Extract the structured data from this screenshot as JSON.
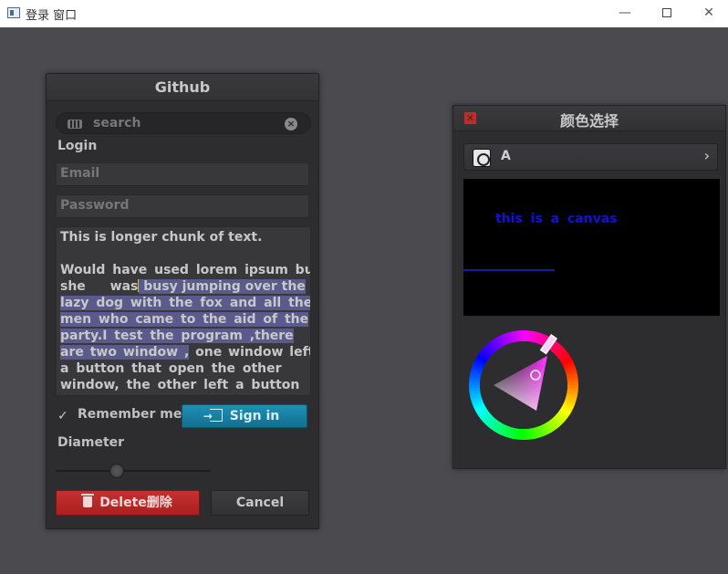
{
  "window": {
    "title": "登录 窗口",
    "minimize": "—",
    "close": "✕"
  },
  "login": {
    "title": "Github",
    "search_placeholder": "search",
    "section_label": "Login",
    "email_placeholder": "Email",
    "password_placeholder": "Password",
    "textarea_lines": [
      "This is longer chunk of text.",
      "",
      "Would have used lorem ipsum but",
      [
        "she    was",
        "busy jumping over the"
      ],
      [
        "",
        "lazy dog with the fox and all the"
      ],
      [
        "",
        "men who came to the aid of the"
      ],
      [
        "",
        "party.I test the program ,there"
      ],
      [
        "",
        "are two window ,",
        " one window left"
      ],
      "a button that open the other",
      "window, the other left a button"
    ],
    "remember_label": "Remember me",
    "remember_checked": true,
    "signin_label": "Sign in",
    "diameter_label": "Diameter",
    "diameter_value": 0.35,
    "delete_label": "Delete删除",
    "cancel_label": "Cancel"
  },
  "color_picker": {
    "title": "颜色选择",
    "selector_label": "A",
    "canvas_text": "this is a canvas",
    "colors": {
      "canvas_bg": "#000000",
      "canvas_text": "#1010e0",
      "selected": "#ff40ff"
    }
  },
  "icons": {
    "search": "keyboard-icon",
    "clear": "clear-icon",
    "signin": "signin-icon",
    "delete": "trash-icon",
    "close": "close-icon",
    "chevron": "chevron-right-icon"
  }
}
